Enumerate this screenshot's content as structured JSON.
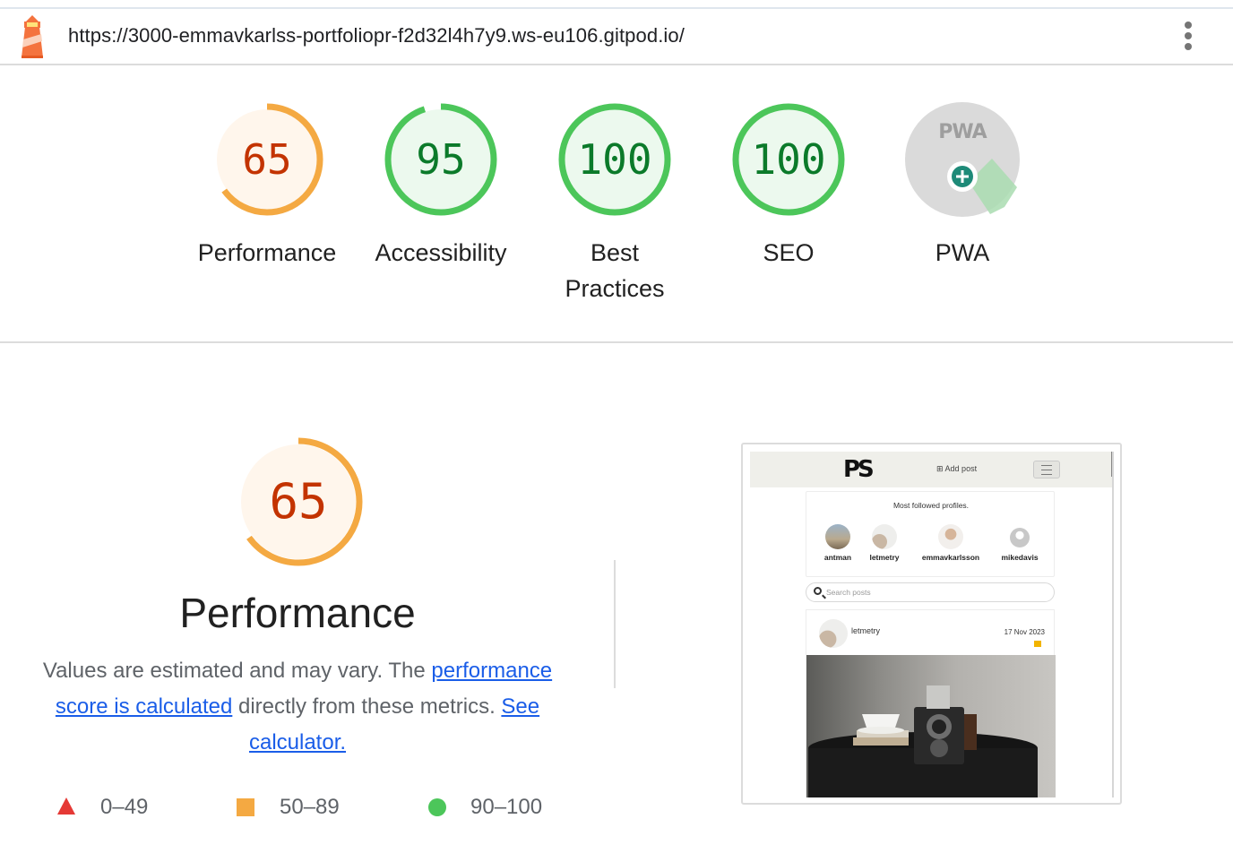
{
  "url": "https://3000-emmavkarlss-portfoliopr-f2d32l4h7y9.ws-eu106.gitpod.io/",
  "colors": {
    "fail": "#e53935",
    "average": "#f4a942",
    "pass": "#4cc65a",
    "link": "#1a5de8"
  },
  "categories": [
    {
      "label": "Performance",
      "score": 65,
      "rating": "average"
    },
    {
      "label": "Accessibility",
      "score": 95,
      "rating": "pass"
    },
    {
      "label": "Best Practices",
      "score": 100,
      "rating": "pass"
    },
    {
      "label": "SEO",
      "score": 100,
      "rating": "pass"
    },
    {
      "label": "PWA",
      "badge": "PWA",
      "rating": "pwa"
    }
  ],
  "performance": {
    "score": 65,
    "title": "Performance",
    "desc_text1": "Values are estimated and may vary. The ",
    "desc_link1": "performance score is calculated",
    "desc_text2": " directly from these metrics. ",
    "desc_link2": "See calculator."
  },
  "legend": {
    "fail": "0–49",
    "average": "50–89",
    "pass": "90–100"
  },
  "screenshot": {
    "logo": "PS",
    "add_post": "Add post",
    "profiles_title": "Most followed profiles.",
    "profiles": [
      "antman",
      "letmetry",
      "emmavkarlsson",
      "mikedavis"
    ],
    "search_placeholder": "Search posts",
    "post_user": "letmetry",
    "post_date": "17 Nov 2023"
  }
}
